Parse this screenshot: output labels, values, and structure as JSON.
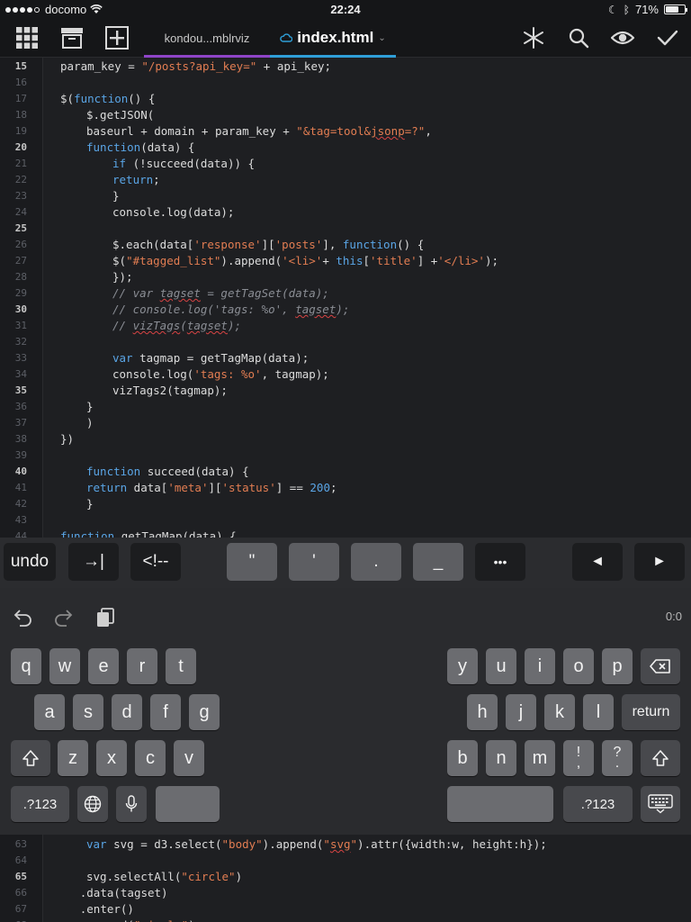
{
  "status_bar": {
    "carrier": "docomo",
    "time": "22:24",
    "battery_percent": "71%",
    "battery_level": 0.71
  },
  "toolbar": {
    "tabs": [
      {
        "label": "kondou...mblrviz",
        "active": false
      },
      {
        "label": "index.html",
        "active": true
      }
    ],
    "left_icons": [
      "grid-icon",
      "archive-icon",
      "plus-icon"
    ],
    "right_icons": [
      "sparkle-icon",
      "search-icon",
      "eye-icon",
      "checkmark-icon"
    ]
  },
  "colors": {
    "keyword": "#5aa5e6",
    "string": "#e27d52",
    "comment": "#8a8d94",
    "tab_inactive_underline": "#8e44c7",
    "tab_active_underline": "#2f9fd8"
  },
  "editor": {
    "lines": [
      {
        "n": "15",
        "bold": true,
        "indent": 4,
        "tokens": [
          [
            "param_key = ",
            "p"
          ],
          [
            "\"/posts?api_key=\"",
            "s"
          ],
          [
            " + api_key;",
            "p"
          ]
        ]
      },
      {
        "n": "16",
        "bold": false,
        "indent": 0,
        "tokens": []
      },
      {
        "n": "17",
        "bold": false,
        "indent": 4,
        "tokens": [
          [
            "$(",
            "p"
          ],
          [
            "function",
            "k"
          ],
          [
            "() {",
            "p"
          ]
        ]
      },
      {
        "n": "18",
        "bold": false,
        "indent": 8,
        "tokens": [
          [
            "$.getJSON(",
            "p"
          ]
        ]
      },
      {
        "n": "19",
        "bold": false,
        "indent": 8,
        "tokens": [
          [
            "baseurl + domain + param_key + ",
            "p"
          ],
          [
            "\"&tag=tool&",
            "s"
          ],
          [
            "jsonp",
            "s",
            "sq"
          ],
          [
            "=?\"",
            "s"
          ],
          [
            ",",
            "p"
          ]
        ]
      },
      {
        "n": "20",
        "bold": true,
        "indent": 8,
        "tokens": [
          [
            "function",
            "k"
          ],
          [
            "(data) {",
            "p"
          ]
        ]
      },
      {
        "n": "21",
        "bold": false,
        "indent": 12,
        "tokens": [
          [
            "if",
            "k"
          ],
          [
            " (!succeed(data)) {",
            "p"
          ]
        ]
      },
      {
        "n": "22",
        "bold": false,
        "indent": 12,
        "tokens": [
          [
            "return",
            "k"
          ],
          [
            ";",
            "p"
          ]
        ]
      },
      {
        "n": "23",
        "bold": false,
        "indent": 12,
        "tokens": [
          [
            "}",
            "p"
          ]
        ]
      },
      {
        "n": "24",
        "bold": false,
        "indent": 12,
        "tokens": [
          [
            "console.log(data);",
            "p"
          ]
        ]
      },
      {
        "n": "25",
        "bold": true,
        "indent": 0,
        "tokens": []
      },
      {
        "n": "26",
        "bold": false,
        "indent": 12,
        "tokens": [
          [
            "$.each(data[",
            "p"
          ],
          [
            "'response'",
            "s"
          ],
          [
            "][",
            "p"
          ],
          [
            "'posts'",
            "s"
          ],
          [
            "], ",
            "p"
          ],
          [
            "function",
            "k"
          ],
          [
            "() {",
            "p"
          ]
        ]
      },
      {
        "n": "27",
        "bold": false,
        "indent": 12,
        "tokens": [
          [
            "$(",
            "p"
          ],
          [
            "\"#tagged_list\"",
            "s"
          ],
          [
            ").append(",
            "p"
          ],
          [
            "'<li>'",
            "s"
          ],
          [
            "+ ",
            "p"
          ],
          [
            "this",
            "k"
          ],
          [
            "[",
            "p"
          ],
          [
            "'title'",
            "s"
          ],
          [
            "] +",
            "p"
          ],
          [
            "'</li>'",
            "s"
          ],
          [
            ");",
            "p"
          ]
        ]
      },
      {
        "n": "28",
        "bold": false,
        "indent": 12,
        "tokens": [
          [
            "});",
            "p"
          ]
        ]
      },
      {
        "n": "29",
        "bold": false,
        "indent": 12,
        "tokens": [
          [
            "// var ",
            "c"
          ],
          [
            "tagset",
            "c",
            "sq"
          ],
          [
            " = getTagSet(data);",
            "c"
          ]
        ]
      },
      {
        "n": "30",
        "bold": true,
        "indent": 12,
        "tokens": [
          [
            "// console.log('tags: %o', ",
            "c"
          ],
          [
            "tagset",
            "c",
            "sq"
          ],
          [
            ");",
            "c"
          ]
        ]
      },
      {
        "n": "31",
        "bold": false,
        "indent": 12,
        "tokens": [
          [
            "// ",
            "c"
          ],
          [
            "vizTags",
            "c",
            "sq"
          ],
          [
            "(",
            "c"
          ],
          [
            "tagset",
            "c",
            "sq"
          ],
          [
            ");",
            "c"
          ]
        ]
      },
      {
        "n": "32",
        "bold": false,
        "indent": 0,
        "tokens": []
      },
      {
        "n": "33",
        "bold": false,
        "indent": 12,
        "tokens": [
          [
            "var",
            "k"
          ],
          [
            " tagmap = getTagMap(data);",
            "p"
          ]
        ]
      },
      {
        "n": "34",
        "bold": false,
        "indent": 12,
        "tokens": [
          [
            "console.log(",
            "p"
          ],
          [
            "'tags: %o'",
            "s"
          ],
          [
            ", tagmap);",
            "p"
          ]
        ]
      },
      {
        "n": "35",
        "bold": true,
        "indent": 12,
        "tokens": [
          [
            "vizTags2(tagmap);",
            "p"
          ]
        ]
      },
      {
        "n": "36",
        "bold": false,
        "indent": 8,
        "tokens": [
          [
            "}",
            "p"
          ]
        ]
      },
      {
        "n": "37",
        "bold": false,
        "indent": 8,
        "tokens": [
          [
            ")",
            "p"
          ]
        ]
      },
      {
        "n": "38",
        "bold": false,
        "indent": 4,
        "tokens": [
          [
            "})",
            "p"
          ]
        ]
      },
      {
        "n": "39",
        "bold": false,
        "indent": 0,
        "tokens": []
      },
      {
        "n": "40",
        "bold": true,
        "indent": 8,
        "tokens": [
          [
            "function",
            "k"
          ],
          [
            " succeed(data) {",
            "p"
          ]
        ]
      },
      {
        "n": "41",
        "bold": false,
        "indent": 8,
        "tokens": [
          [
            "return",
            "k"
          ],
          [
            " data[",
            "p"
          ],
          [
            "'meta'",
            "s"
          ],
          [
            "][",
            "p"
          ],
          [
            "'status'",
            "s"
          ],
          [
            "] == ",
            "p"
          ],
          [
            "200",
            "n"
          ],
          [
            ";",
            "p"
          ]
        ]
      },
      {
        "n": "42",
        "bold": false,
        "indent": 8,
        "tokens": [
          [
            "}",
            "p"
          ]
        ]
      },
      {
        "n": "43",
        "bold": false,
        "indent": 0,
        "tokens": []
      },
      {
        "n": "44",
        "bold": false,
        "indent": 4,
        "tokens": [
          [
            "function",
            "k"
          ],
          [
            " getTagMap(data) {",
            "p"
          ]
        ]
      }
    ],
    "bottom_lines": [
      {
        "n": "63",
        "bold": false,
        "indent": 8,
        "tokens": [
          [
            "var",
            "k"
          ],
          [
            " svg = d3.select(",
            "p"
          ],
          [
            "\"body\"",
            "s"
          ],
          [
            ").append(",
            "p"
          ],
          [
            "\"",
            "s"
          ],
          [
            "svg",
            "s",
            "sq"
          ],
          [
            "\"",
            "s"
          ],
          [
            ").attr({width:w, height:h});",
            "p"
          ]
        ]
      },
      {
        "n": "64",
        "bold": false,
        "indent": 0,
        "tokens": []
      },
      {
        "n": "65",
        "bold": true,
        "indent": 8,
        "tokens": [
          [
            "svg.selectAll(",
            "p"
          ],
          [
            "\"circle\"",
            "s"
          ],
          [
            ")",
            "p"
          ]
        ]
      },
      {
        "n": "66",
        "bold": false,
        "indent": 7,
        "tokens": [
          [
            ".data(tagset)",
            "p"
          ]
        ]
      },
      {
        "n": "67",
        "bold": false,
        "indent": 7,
        "tokens": [
          [
            ".enter()",
            "p"
          ]
        ]
      },
      {
        "n": "68",
        "bold": false,
        "indent": 7,
        "tokens": [
          [
            ".append(",
            "p"
          ],
          [
            "\"circle\"",
            "s"
          ],
          [
            ")",
            "p"
          ]
        ]
      }
    ]
  },
  "accessory_bar": {
    "keys": [
      {
        "label": "undo",
        "style": "dark"
      },
      {
        "label": "→|",
        "style": "dark"
      },
      {
        "label": "<!--",
        "style": "dark"
      },
      {
        "label": "\"",
        "style": "light"
      },
      {
        "label": "'",
        "style": "light"
      },
      {
        "label": ".",
        "style": "light"
      },
      {
        "label": "_",
        "style": "light"
      },
      {
        "label": "•••",
        "style": "dark"
      },
      {
        "label": "◄",
        "style": "dark"
      },
      {
        "label": "►",
        "style": "dark"
      }
    ]
  },
  "keyboard": {
    "counter": "0:0",
    "top_icons": [
      "undo-arrow-icon",
      "redo-arrow-icon",
      "paste-icon"
    ],
    "row1_left": [
      "q",
      "w",
      "e",
      "r",
      "t"
    ],
    "row1_right": [
      "y",
      "u",
      "i",
      "o",
      "p"
    ],
    "row2_left": [
      "a",
      "s",
      "d",
      "f",
      "g"
    ],
    "row2_right": [
      "h",
      "j",
      "k",
      "l"
    ],
    "return_label": "return",
    "row3_left": [
      "z",
      "x",
      "c",
      "v"
    ],
    "row3_right": [
      "b",
      "n",
      "m"
    ],
    "row3_punct": [
      [
        "!",
        ","
      ],
      [
        "?",
        "."
      ]
    ],
    "numbers_label": ".?123"
  }
}
